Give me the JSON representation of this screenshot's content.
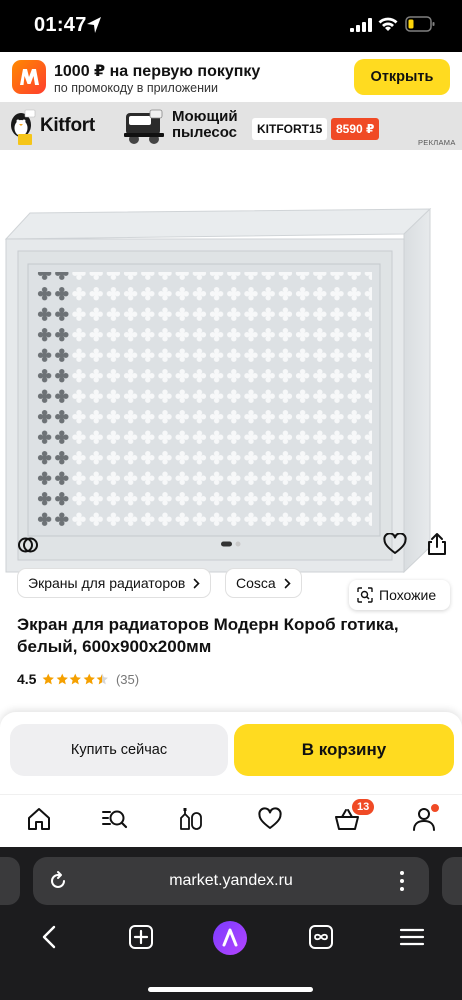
{
  "status_bar": {
    "time": "01:47"
  },
  "promo": {
    "title": "1000 ₽ на первую покупку",
    "subtitle": "по промокоду в приложении",
    "open_button": "Открыть"
  },
  "ad": {
    "brand": "Kitfort",
    "product": "Моющий пылесос",
    "promo_code": "KITFORT15",
    "price": "8590 ₽",
    "tag": "РЕКЛАМА"
  },
  "product": {
    "similar_label": "Похожие",
    "breadcrumbs": [
      {
        "label": "Экраны для радиаторов"
      },
      {
        "label": "Cosca"
      }
    ],
    "title": "Экран для радиаторов Модерн Короб готика, белый, 600x900x200мм",
    "rating": "4.5",
    "rating_value": 4.5,
    "reviews": "(35)",
    "image_count": 2,
    "active_image": 1
  },
  "actions": {
    "buy_now": "Купить сейчас",
    "add_to_cart": "В корзину"
  },
  "tabbar": {
    "tabs": [
      {
        "name": "home-icon"
      },
      {
        "name": "catalog-search-icon"
      },
      {
        "name": "compare-icon"
      },
      {
        "name": "favorites-icon"
      },
      {
        "name": "cart-icon"
      },
      {
        "name": "profile-icon"
      }
    ],
    "cart_count": "13"
  },
  "browser": {
    "url": "market.yandex.ru"
  },
  "colors": {
    "accent_yellow": "#ffdb20",
    "badge_red": "#f04a25"
  }
}
